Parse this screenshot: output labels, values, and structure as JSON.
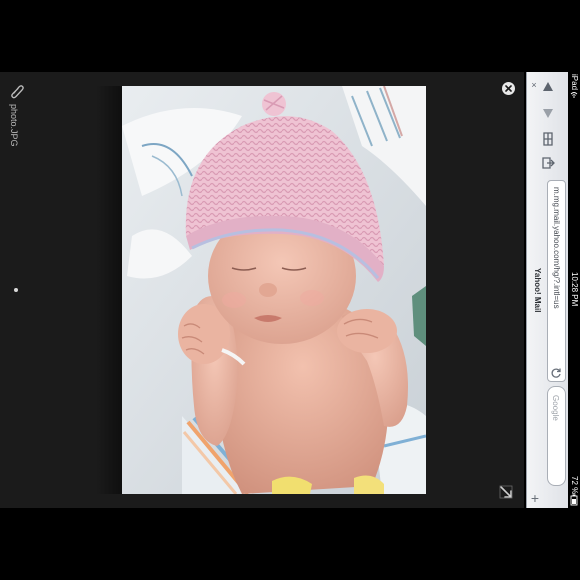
{
  "viewer": {
    "file_name": "photo.JPG",
    "icons": {
      "attach": "paperclip-icon",
      "close": "close-circle-icon",
      "expand": "expand-arrow-icon"
    },
    "photo_alt": "newborn baby in pink knit hat"
  },
  "browser": {
    "tab_close": "×",
    "url": "m.mg.mail.yahoo.com/hg/?.intl=us",
    "page_title": "Yahoo! Mail",
    "search_placeholder": "Google",
    "add_tab": "+",
    "icons": {
      "back": "triangle-back-icon",
      "forward": "triangle-forward-icon",
      "bookmarks": "book-icon",
      "share": "share-icon",
      "reload": "reload-icon"
    }
  },
  "status_bar": {
    "device": "iPad",
    "time": "10:28 PM",
    "battery": "72 %"
  },
  "colors": {
    "viewer_bg": "#1b1b1b",
    "browser_bg": "#e6e8ec",
    "status_bg": "#000000"
  }
}
